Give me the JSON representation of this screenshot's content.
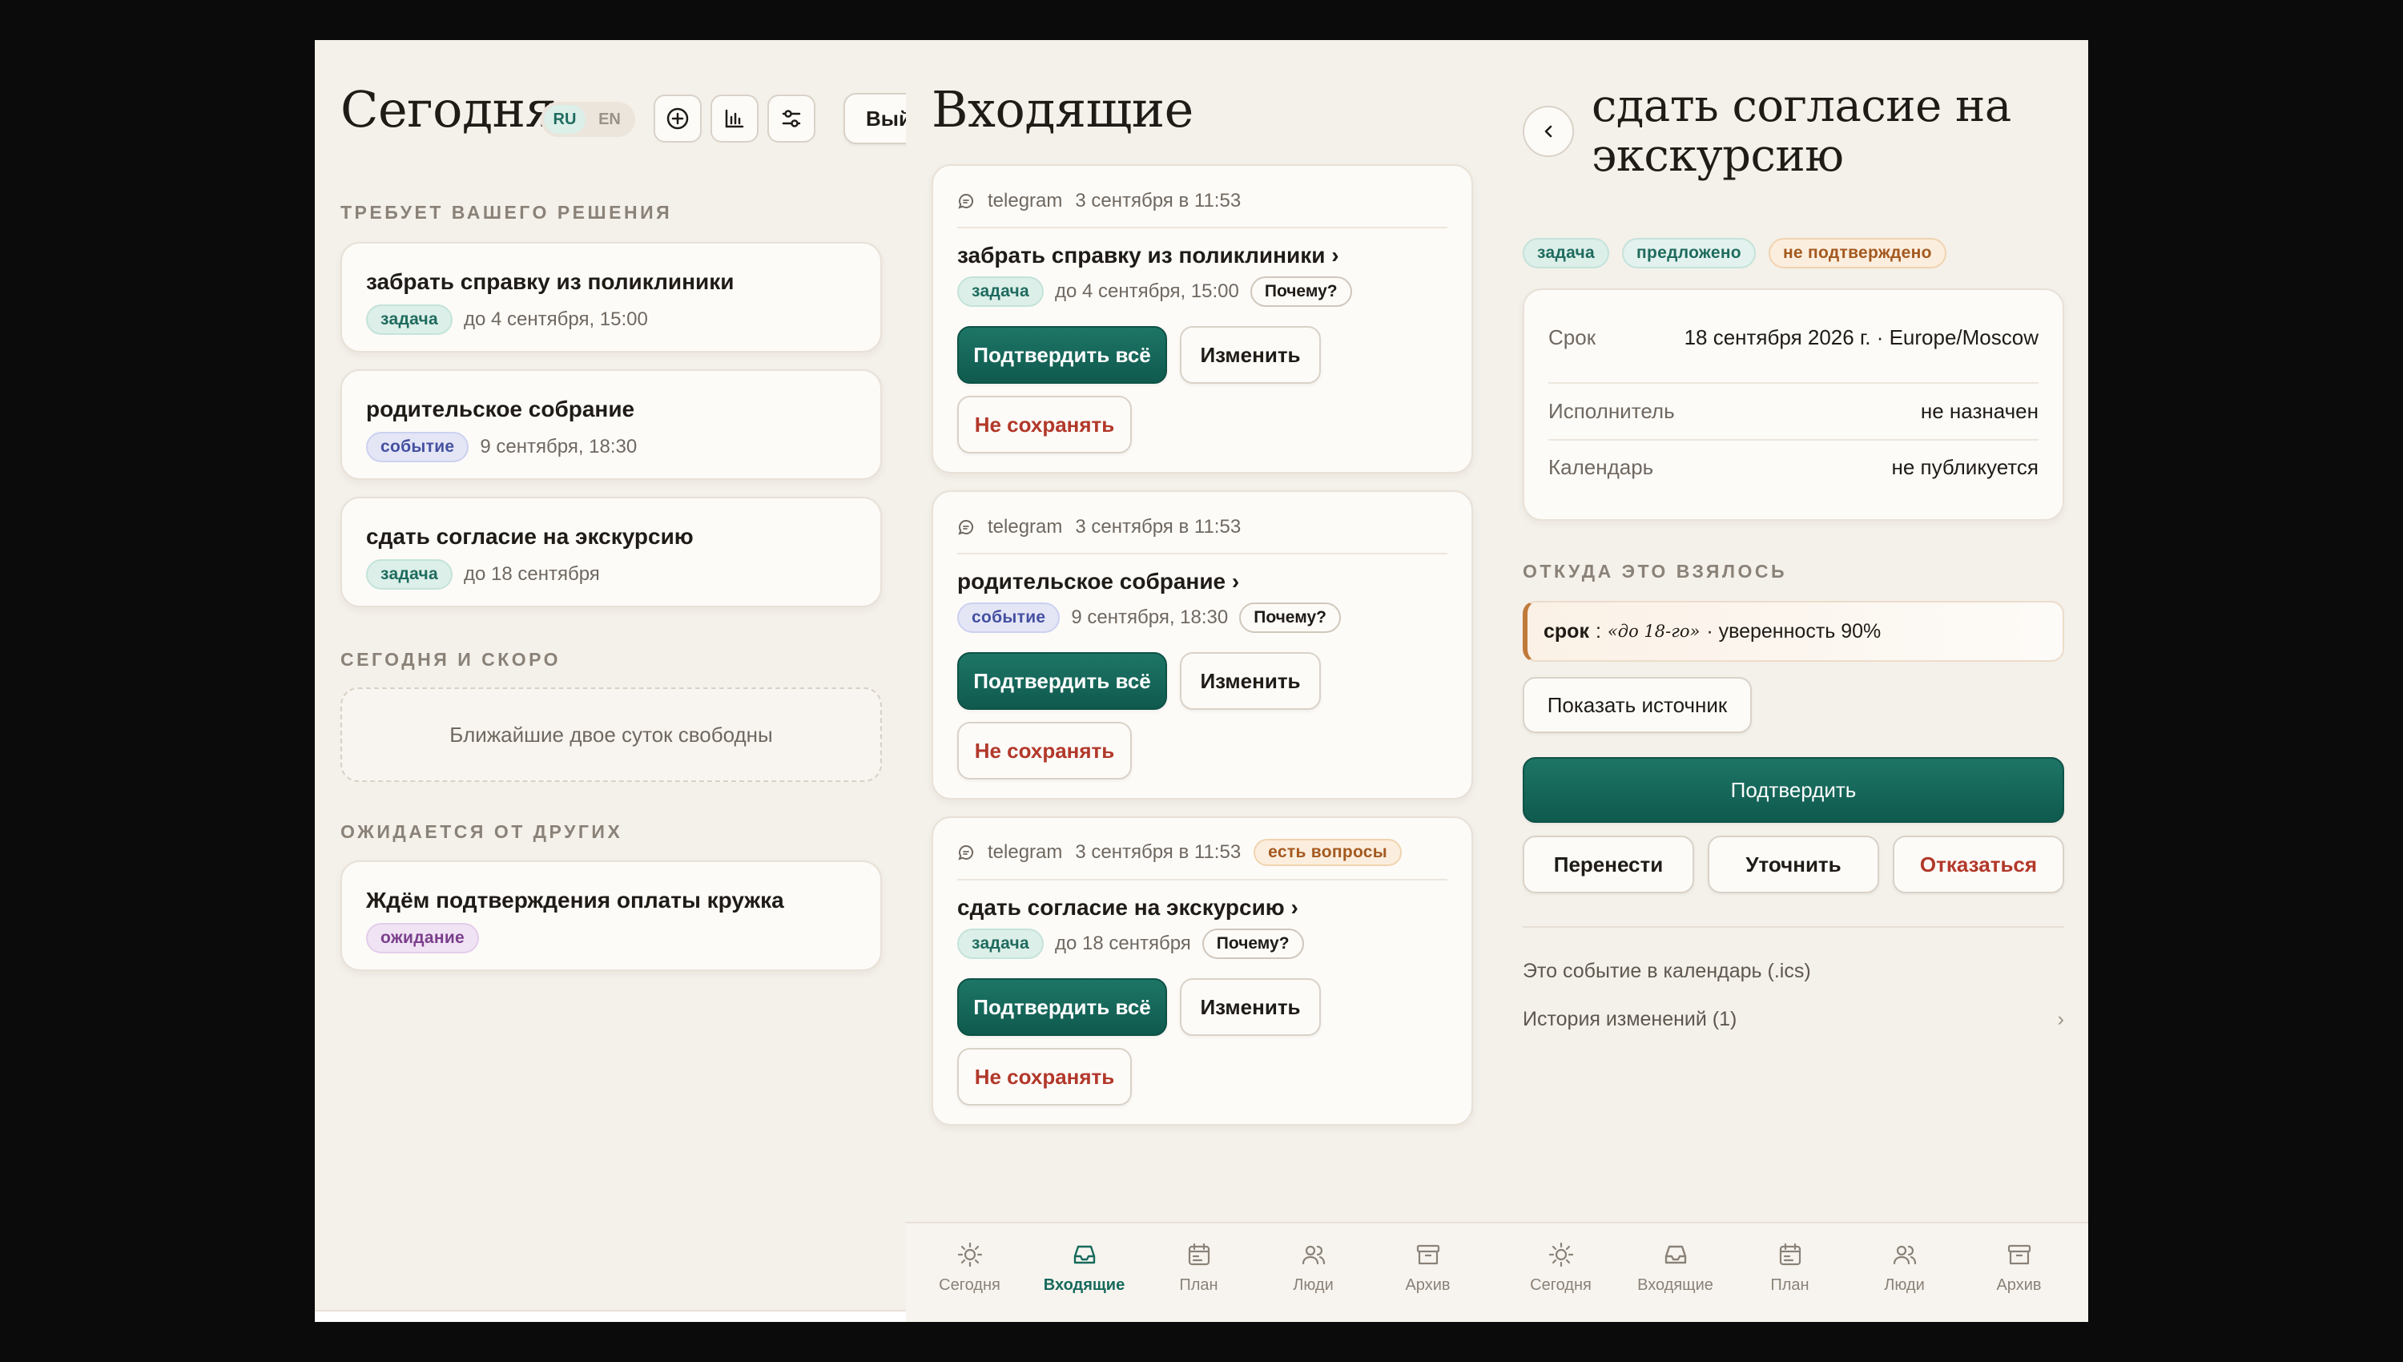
{
  "today": {
    "title": "Сегодня",
    "lang": {
      "ru": "RU",
      "en": "EN"
    },
    "exit_label": "Выйти",
    "sections": {
      "decision": "ТРЕБУЕТ ВАШЕГО РЕШЕНИЯ",
      "soon": "СЕГОДНЯ И СКОРО",
      "others": "ОЖИДАЕТСЯ ОТ ДРУГИХ"
    },
    "items": [
      {
        "title": "забрать справку из поликлиники",
        "tag": "задача",
        "meta": "до 4 сентября, 15:00"
      },
      {
        "title": "родительское собрание",
        "tag": "событие",
        "meta": "9 сентября, 18:30"
      },
      {
        "title": "сдать согласие на экскурсию",
        "tag": "задача",
        "meta": "до 18 сентября"
      }
    ],
    "soon_empty": "Ближайшие двое суток свободны",
    "waiting": {
      "title": "Ждём подтверждения оплаты кружка",
      "tag": "ожидание"
    }
  },
  "inbox": {
    "title": "Входящие",
    "confirm_all": "Подтвердить всё",
    "edit": "Изменить",
    "dont_save": "Не сохранять",
    "why": "Почему?",
    "cards": [
      {
        "source": "telegram",
        "time": "3 сентября в 11:53",
        "title": "забрать справку из поликлиники ›",
        "tag": "задача",
        "meta": "до 4 сентября, 15:00"
      },
      {
        "source": "telegram",
        "time": "3 сентября в 11:53",
        "title": "родительское собрание ›",
        "tag": "событие",
        "meta": "9 сентября, 18:30"
      },
      {
        "source": "telegram",
        "time": "3 сентября в 11:53",
        "badge": "есть вопросы",
        "title": "сдать согласие на экскурсию ›",
        "tag": "задача",
        "meta": "до 18 сентября"
      }
    ]
  },
  "detail": {
    "title_line1": "сдать согласие на",
    "title_line2": "экскурсию",
    "tags": [
      "задача",
      "предложено",
      "не подтверждено"
    ],
    "fields": [
      {
        "label": "Срок",
        "value": "18 сентября 2026 г. · Europe/Moscow"
      },
      {
        "label": "Исполнитель",
        "value": "не назначен"
      },
      {
        "label": "Календарь",
        "value": "не публикуется"
      }
    ],
    "origin_label": "ОТКУДА ЭТО ВЗЯЛОСЬ",
    "evidence": {
      "key": "срок",
      "quote": "«до 18-го»",
      "confidence": "· уверенность 90%"
    },
    "show_source": "Показать источник",
    "confirm": "Подтвердить",
    "reschedule": "Перенести",
    "clarify": "Уточнить",
    "decline": "Отказаться",
    "ics_link": "Это событие в календарь (.ics)",
    "history": "История изменений (1)",
    "history_chevron": "›"
  },
  "nav": [
    {
      "label": "Сегодня",
      "icon": "sun-icon"
    },
    {
      "label": "Входящие",
      "icon": "inbox-icon"
    },
    {
      "label": "План",
      "icon": "calendar-icon"
    },
    {
      "label": "Люди",
      "icon": "people-icon"
    },
    {
      "label": "Архив",
      "icon": "archive-icon"
    }
  ],
  "colors": {
    "accent": "#16695b",
    "danger": "#b2382a",
    "background": "#f4f0ea"
  }
}
